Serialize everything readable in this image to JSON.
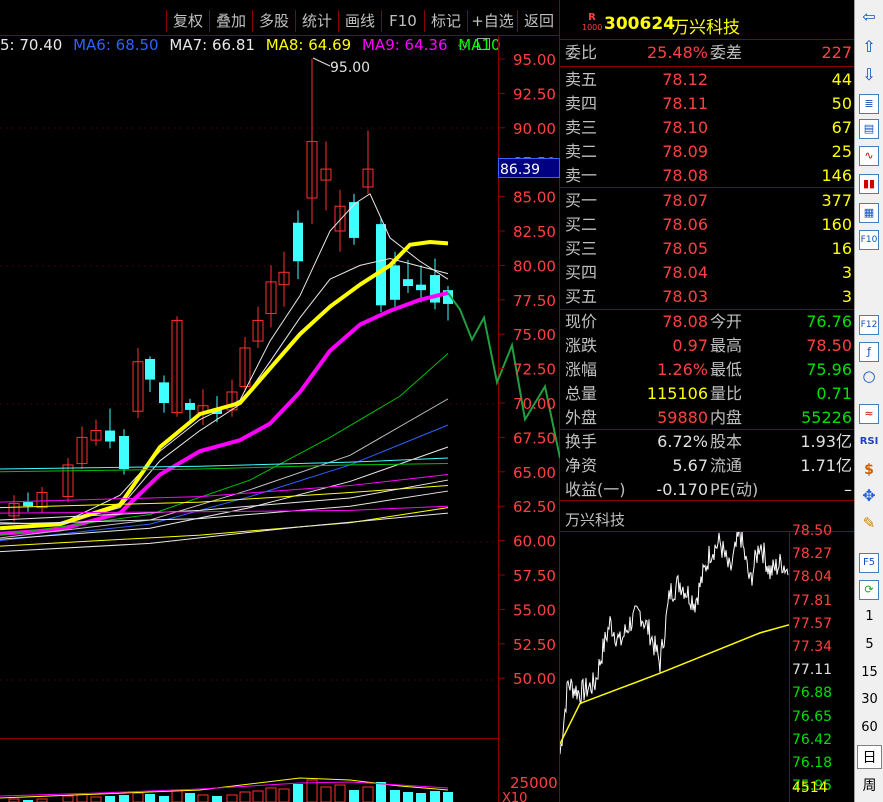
{
  "toolbar": {
    "buttons": [
      "复权",
      "叠加",
      "多股",
      "统计",
      "画线",
      "F10",
      "标记",
      "+自选",
      "返回"
    ]
  },
  "ma_line": {
    "items": [
      {
        "label": "5: 70.40",
        "color": "#e8e8e8"
      },
      {
        "label": "MA6: 68.50",
        "color": "#3060ff"
      },
      {
        "label": "MA7: 66.81",
        "color": "#e8e8e8"
      },
      {
        "label": "MA8: 64.69",
        "color": "#ffff00"
      },
      {
        "label": "MA9: 64.36",
        "color": "#ff00ff"
      },
      {
        "label": "MA10",
        "color": "#00ff00"
      }
    ]
  },
  "main_chart": {
    "price_axis": [
      "95.00",
      "92.50",
      "90.00",
      "87.50",
      "85.00",
      "82.50",
      "80.00",
      "77.50",
      "75.00",
      "72.50",
      "70.00",
      "67.50",
      "65.00",
      "62.50",
      "60.00",
      "57.50",
      "55.00",
      "52.50",
      "50.00"
    ],
    "high_label": "95.00",
    "cursor_price": "86.39",
    "volume_axis": [
      "25000",
      "X10"
    ]
  },
  "stock": {
    "code": "300624",
    "name": "万兴科技",
    "badge_top": "R",
    "badge_bottom": "1000"
  },
  "order_book": {
    "weibi_label": "委比",
    "weibi_value": "25.48%",
    "weicha_label": "委差",
    "weicha_value": "227",
    "asks": [
      {
        "label": "卖五",
        "price": "78.12",
        "vol": "44"
      },
      {
        "label": "卖四",
        "price": "78.11",
        "vol": "50"
      },
      {
        "label": "卖三",
        "price": "78.10",
        "vol": "67"
      },
      {
        "label": "卖二",
        "price": "78.09",
        "vol": "25"
      },
      {
        "label": "卖一",
        "price": "78.08",
        "vol": "146"
      }
    ],
    "bids": [
      {
        "label": "买一",
        "price": "78.07",
        "vol": "377"
      },
      {
        "label": "买二",
        "price": "78.06",
        "vol": "160"
      },
      {
        "label": "买三",
        "price": "78.05",
        "vol": "16"
      },
      {
        "label": "买四",
        "price": "78.04",
        "vol": "3"
      },
      {
        "label": "买五",
        "price": "78.03",
        "vol": "3"
      }
    ]
  },
  "quote": {
    "rows": [
      {
        "l1": "现价",
        "v1": "78.08",
        "c1": "#ff4040",
        "l2": "今开",
        "v2": "76.76",
        "c2": "#00e000"
      },
      {
        "l1": "涨跌",
        "v1": "0.97",
        "c1": "#ff4040",
        "l2": "最高",
        "v2": "78.50",
        "c2": "#ff4040"
      },
      {
        "l1": "涨幅",
        "v1": "1.26%",
        "c1": "#ff4040",
        "l2": "最低",
        "v2": "75.96",
        "c2": "#00e000"
      },
      {
        "l1": "总量",
        "v1": "115106",
        "c1": "#ffff00",
        "l2": "量比",
        "v2": "0.71",
        "c2": "#00e000"
      },
      {
        "l1": "外盘",
        "v1": "59880",
        "c1": "#ff4040",
        "l2": "内盘",
        "v2": "55226",
        "c2": "#00e000"
      }
    ],
    "rows2": [
      {
        "l1": "换手",
        "v1": "6.72%",
        "l2": "股本",
        "v2": "1.93亿"
      },
      {
        "l1": "净资",
        "v1": "5.67",
        "l2": "流通",
        "v2": "1.71亿"
      },
      {
        "l1": "收益(一)",
        "v1": "-0.170",
        "l2": "PE(动)",
        "v2": "–"
      }
    ]
  },
  "mini_chart": {
    "title": "万兴科技",
    "axis": [
      {
        "v": "78.50",
        "c": "#ff4040"
      },
      {
        "v": "78.27",
        "c": "#ff4040"
      },
      {
        "v": "78.04",
        "c": "#ff4040"
      },
      {
        "v": "77.81",
        "c": "#ff4040"
      },
      {
        "v": "77.57",
        "c": "#ff4040"
      },
      {
        "v": "77.34",
        "c": "#ff4040"
      },
      {
        "v": "77.11",
        "c": "#e0e0e0"
      },
      {
        "v": "76.88",
        "c": "#00e000"
      },
      {
        "v": "76.65",
        "c": "#00e000"
      },
      {
        "v": "76.42",
        "c": "#00e000"
      },
      {
        "v": "76.18",
        "c": "#00e000"
      },
      {
        "v": "75.95",
        "c": "#00e000"
      }
    ],
    "volume_label": "4514"
  },
  "sidebar": {
    "periods": [
      "1",
      "5",
      "15",
      "30",
      "60"
    ],
    "day_label": "日",
    "week_label": "周",
    "icons": [
      "arrow-left-icon",
      "arrow-up-icon",
      "arrow-down-icon",
      "list-icon",
      "detail-icon",
      "line-chart-icon",
      "candle-icon",
      "report-icon",
      "f10-icon",
      "f12-icon",
      "formula-icon",
      "circle-icon",
      "wave-icon",
      "rsi-icon",
      "money-icon",
      "move-icon",
      "pen-icon",
      "f5-icon",
      "refresh-icon"
    ],
    "rsi_label": "RSI",
    "f5_label": "F5",
    "f10_label": "F10",
    "f12_label": "F12"
  }
}
